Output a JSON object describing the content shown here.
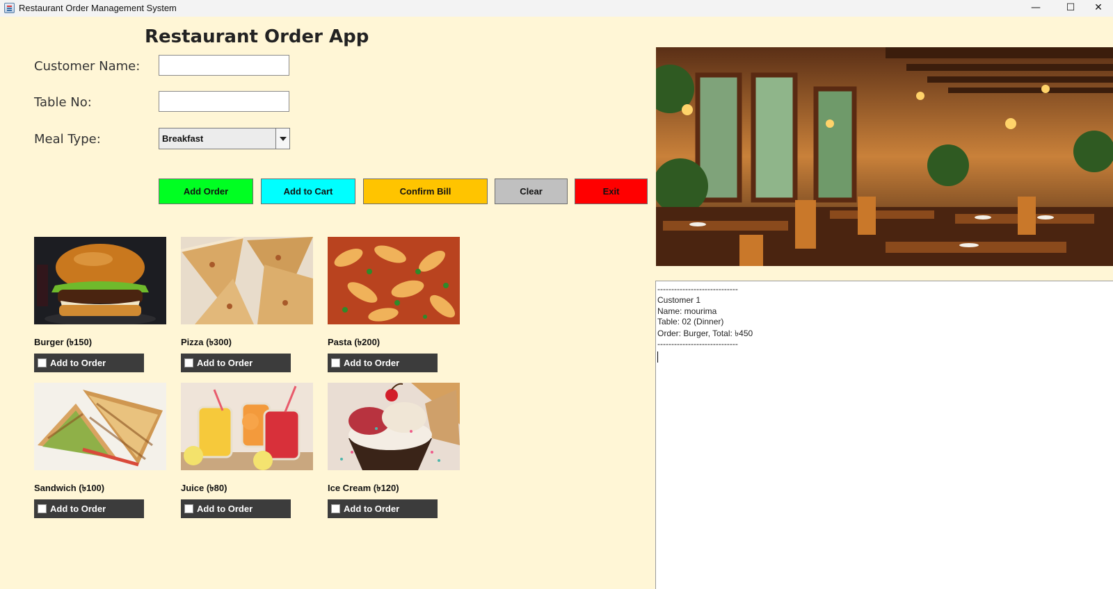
{
  "window": {
    "title": "Restaurant Order Management System",
    "controls": {
      "minimize": "—",
      "maximize": "☐",
      "close": "✕"
    }
  },
  "app": {
    "title": "Restaurant Order App"
  },
  "form": {
    "customer_name": {
      "label": "Customer Name:",
      "value": ""
    },
    "table_no": {
      "label": "Table No:",
      "value": ""
    },
    "meal_type": {
      "label": "Meal Type:",
      "selected": "Breakfast"
    }
  },
  "actions": [
    {
      "label": "Add Order",
      "color": "#00ff22"
    },
    {
      "label": "Add to Cart",
      "color": "#00ffff"
    },
    {
      "label": "Confirm Bill",
      "color": "#ffc400"
    },
    {
      "label": "Clear",
      "color": "#c0c0c0"
    },
    {
      "label": "Exit",
      "color": "#ff0000"
    }
  ],
  "menu": [
    {
      "name": "Burger (৳150)",
      "button": "Add to Order",
      "icon": "burger-photo"
    },
    {
      "name": "Pizza (৳300)",
      "button": "Add to Order",
      "icon": "pizza-photo"
    },
    {
      "name": "Pasta (৳200)",
      "button": "Add to Order",
      "icon": "pasta-photo"
    },
    {
      "name": "Sandwich (৳100)",
      "button": "Add to Order",
      "icon": "sandwich-photo"
    },
    {
      "name": "Juice (৳80)",
      "button": "Add to Order",
      "icon": "juice-photo"
    },
    {
      "name": "Ice Cream (৳120)",
      "button": "Add to Order",
      "icon": "ice-cream-photo"
    }
  ],
  "bill": {
    "lines": [
      "-----------------------------",
      "Customer 1",
      "Name: mourima",
      "Table: 02 (Dinner)",
      "Order: Burger, Total: ৳450",
      "-----------------------------"
    ]
  }
}
